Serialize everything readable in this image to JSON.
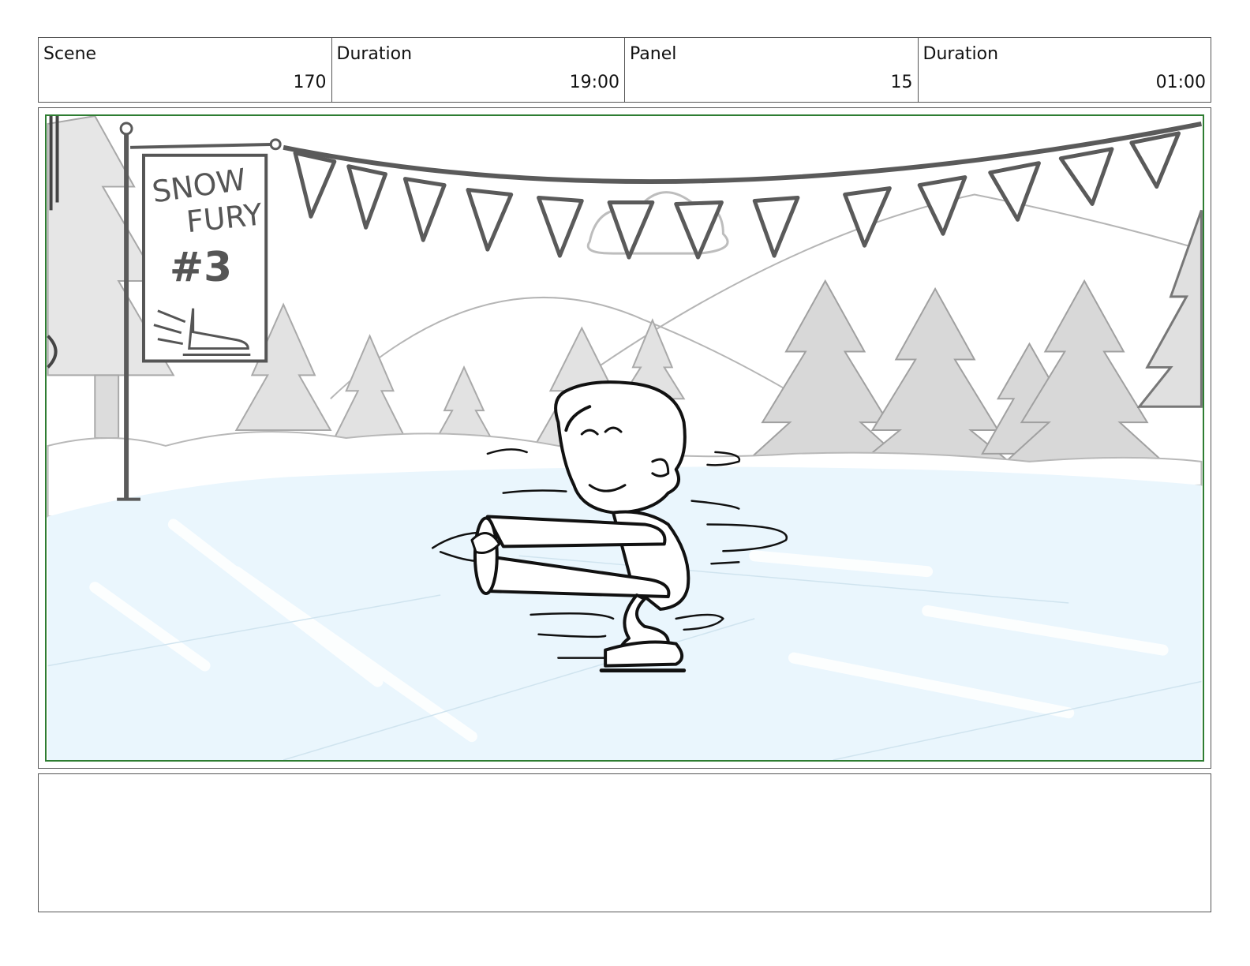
{
  "header": {
    "cells": [
      {
        "label": "Scene",
        "value": "170"
      },
      {
        "label": "Duration",
        "value": "19:00"
      },
      {
        "label": "Panel",
        "value": "15"
      },
      {
        "label": "Duration",
        "value": "01:00"
      }
    ]
  },
  "panel": {
    "sign": {
      "line1": "SNOW",
      "line2": "FURY",
      "line3": "#3"
    },
    "icons": [
      "ice-skate-icon"
    ],
    "colors": {
      "frame_border": "#2e7d32",
      "ice": "#eaf6fd",
      "sketch_line": "#555555"
    }
  },
  "notes": {
    "text": ""
  }
}
